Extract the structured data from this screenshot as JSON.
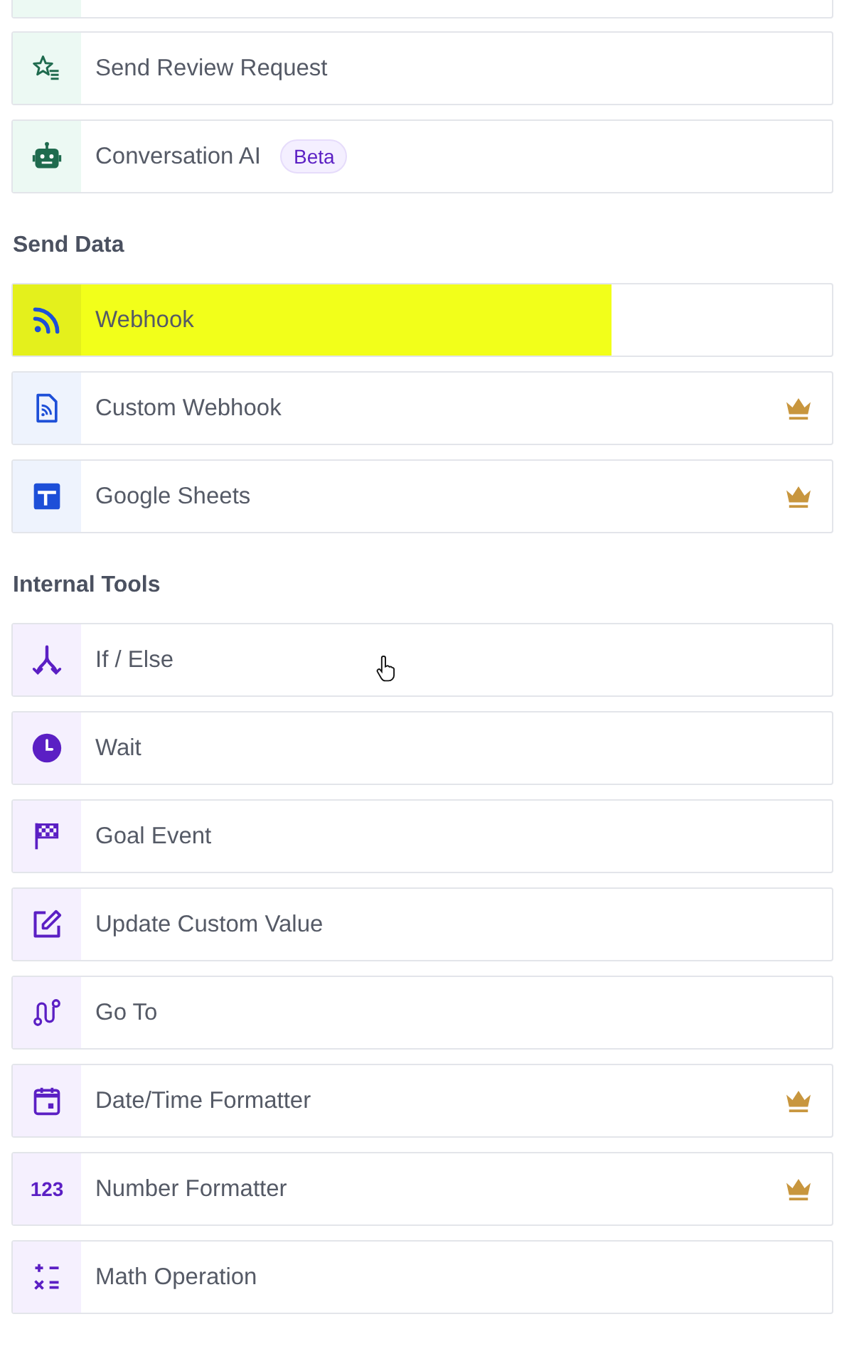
{
  "sections": [
    {
      "items": [
        {
          "label": "Send Review Request",
          "premium": false,
          "highlighted": false
        },
        {
          "label": "Conversation AI",
          "badge": "Beta",
          "premium": false,
          "highlighted": false
        }
      ]
    },
    {
      "heading": "Send Data",
      "items": [
        {
          "label": "Webhook",
          "premium": false,
          "highlighted": true
        },
        {
          "label": "Custom Webhook",
          "premium": true,
          "highlighted": false
        },
        {
          "label": "Google Sheets",
          "premium": true,
          "highlighted": false
        }
      ]
    },
    {
      "heading": "Internal Tools",
      "items": [
        {
          "label": "If / Else",
          "premium": false,
          "highlighted": false,
          "pointer": true
        },
        {
          "label": "Wait",
          "premium": false,
          "highlighted": false
        },
        {
          "label": "Goal Event",
          "premium": false,
          "highlighted": false
        },
        {
          "label": "Update Custom Value",
          "premium": false,
          "highlighted": false
        },
        {
          "label": "Go To",
          "premium": false,
          "highlighted": false
        },
        {
          "label": "Date/Time Formatter",
          "premium": true,
          "highlighted": false
        },
        {
          "label": "Number Formatter",
          "icon_text": "123",
          "premium": true,
          "highlighted": false
        },
        {
          "label": "Math Operation",
          "premium": false,
          "highlighted": false
        }
      ]
    }
  ]
}
